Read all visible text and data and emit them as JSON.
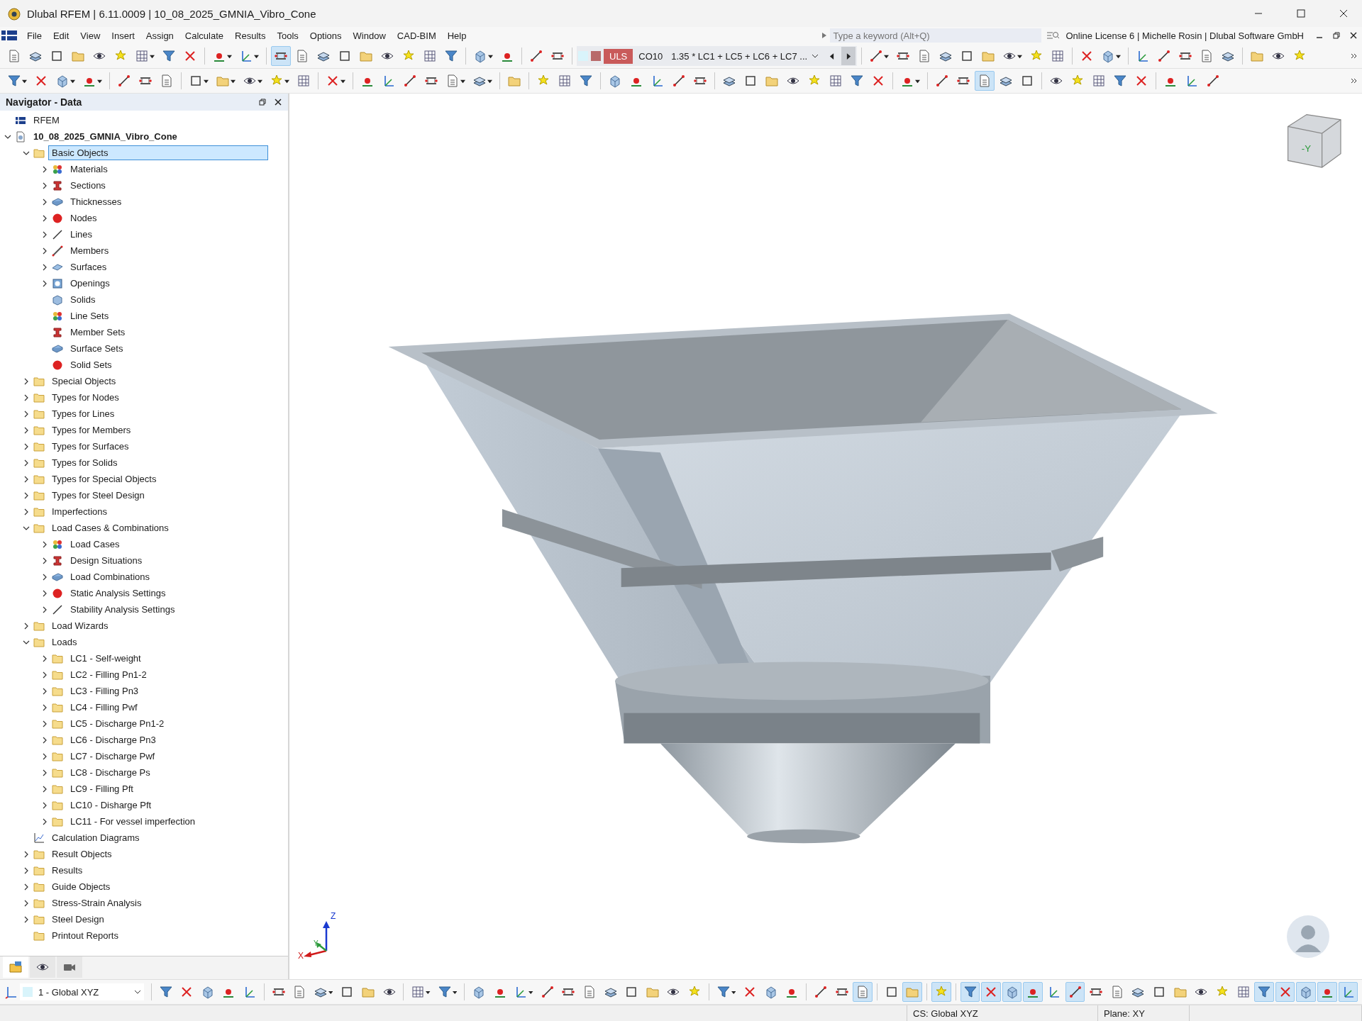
{
  "window": {
    "title": "Dlubal RFEM | 6.11.0009 | 10_08_2025_GMNIA_Vibro_Cone"
  },
  "menu": [
    "File",
    "Edit",
    "View",
    "Insert",
    "Assign",
    "Calculate",
    "Results",
    "Tools",
    "Options",
    "Window",
    "CAD-BIM",
    "Help"
  ],
  "search": {
    "placeholder": "Type a keyword (Alt+Q)"
  },
  "license": "Online License 6 | Michelle Rosin | Dlubal Software GmbH",
  "toolbar_top": {
    "left": [
      {
        "kind": "button",
        "selected": false
      },
      {
        "kind": "button",
        "selected": false
      },
      {
        "kind": "button",
        "selected": false
      },
      {
        "kind": "button",
        "selected": false
      },
      {
        "kind": "button",
        "selected": false
      },
      {
        "kind": "button",
        "selected": false
      },
      {
        "kind": "dropdown",
        "selected": false
      },
      {
        "kind": "button",
        "selected": false
      },
      {
        "kind": "button",
        "selected": false
      },
      {
        "kind": "separator"
      },
      {
        "kind": "dropdown",
        "selected": false
      },
      {
        "kind": "dropdown",
        "selected": false
      },
      {
        "kind": "separator"
      },
      {
        "kind": "button",
        "selected": true
      },
      {
        "kind": "button",
        "selected": false
      },
      {
        "kind": "button",
        "selected": false
      },
      {
        "kind": "button",
        "selected": false
      },
      {
        "kind": "button",
        "selected": false
      },
      {
        "kind": "button",
        "selected": false
      },
      {
        "kind": "button",
        "selected": false
      },
      {
        "kind": "button",
        "selected": false
      },
      {
        "kind": "button",
        "selected": false
      },
      {
        "kind": "separator"
      },
      {
        "kind": "dropdown",
        "selected": false
      },
      {
        "kind": "button",
        "selected": false
      },
      {
        "kind": "separator"
      },
      {
        "kind": "button",
        "selected": false
      },
      {
        "kind": "button",
        "selected": false
      }
    ],
    "load_selector": {
      "badge": "ULS",
      "code": "CO10",
      "combination": "1.35 * LC1 + LC5 + LC6 + LC7 ...",
      "nav": [
        {
          "selected": false
        },
        {
          "selected": true
        }
      ]
    },
    "right": [
      {
        "kind": "dropdown",
        "selected": false
      },
      {
        "kind": "button",
        "selected": false
      },
      {
        "kind": "button",
        "selected": false
      },
      {
        "kind": "button",
        "selected": false
      },
      {
        "kind": "button",
        "selected": false
      },
      {
        "kind": "button",
        "selected": false
      },
      {
        "kind": "dropdown",
        "selected": false
      },
      {
        "kind": "button",
        "selected": false
      },
      {
        "kind": "button",
        "selected": false
      },
      {
        "kind": "separator"
      },
      {
        "kind": "button",
        "selected": false
      },
      {
        "kind": "dropdown",
        "selected": false
      },
      {
        "kind": "separator"
      },
      {
        "kind": "button",
        "selected": false
      },
      {
        "kind": "button",
        "selected": false
      },
      {
        "kind": "button",
        "selected": false
      },
      {
        "kind": "button",
        "selected": false
      },
      {
        "kind": "button",
        "selected": false
      },
      {
        "kind": "separator"
      },
      {
        "kind": "button",
        "selected": false
      },
      {
        "kind": "button",
        "selected": false
      },
      {
        "kind": "button",
        "selected": false
      }
    ]
  },
  "toolbar_second": [
    {
      "kind": "dropdown",
      "selected": false
    },
    {
      "kind": "button",
      "selected": false
    },
    {
      "kind": "dropdown",
      "selected": false
    },
    {
      "kind": "dropdown",
      "selected": false
    },
    {
      "kind": "separator"
    },
    {
      "kind": "button",
      "selected": false
    },
    {
      "kind": "button",
      "selected": false
    },
    {
      "kind": "button",
      "selected": false
    },
    {
      "kind": "separator"
    },
    {
      "kind": "dropdown",
      "selected": false
    },
    {
      "kind": "dropdown",
      "selected": false
    },
    {
      "kind": "dropdown",
      "selected": false
    },
    {
      "kind": "dropdown",
      "selected": false
    },
    {
      "kind": "button",
      "selected": false
    },
    {
      "kind": "separator"
    },
    {
      "kind": "dropdown",
      "selected": false
    },
    {
      "kind": "separator"
    },
    {
      "kind": "button",
      "selected": false
    },
    {
      "kind": "button",
      "selected": false
    },
    {
      "kind": "button",
      "selected": false
    },
    {
      "kind": "button",
      "selected": false
    },
    {
      "kind": "dropdown",
      "selected": false
    },
    {
      "kind": "dropdown",
      "selected": false
    },
    {
      "kind": "separator"
    },
    {
      "kind": "button",
      "selected": false
    },
    {
      "kind": "separator"
    },
    {
      "kind": "button",
      "selected": false
    },
    {
      "kind": "button",
      "selected": false
    },
    {
      "kind": "button",
      "selected": false
    },
    {
      "kind": "separator"
    },
    {
      "kind": "button",
      "selected": false
    },
    {
      "kind": "button",
      "selected": false
    },
    {
      "kind": "button",
      "selected": false
    },
    {
      "kind": "button",
      "selected": false
    },
    {
      "kind": "button",
      "selected": false
    },
    {
      "kind": "separator"
    },
    {
      "kind": "button",
      "selected": false
    },
    {
      "kind": "button",
      "selected": false
    },
    {
      "kind": "button",
      "selected": false
    },
    {
      "kind": "button",
      "selected": false
    },
    {
      "kind": "button",
      "selected": false
    },
    {
      "kind": "button",
      "selected": false
    },
    {
      "kind": "button",
      "selected": false
    },
    {
      "kind": "button",
      "selected": false
    },
    {
      "kind": "separator"
    },
    {
      "kind": "dropdown",
      "selected": false
    },
    {
      "kind": "separator"
    },
    {
      "kind": "button",
      "selected": false
    },
    {
      "kind": "button",
      "selected": false
    },
    {
      "kind": "button",
      "selected": true
    },
    {
      "kind": "button",
      "selected": false
    },
    {
      "kind": "button",
      "selected": false
    },
    {
      "kind": "separator"
    },
    {
      "kind": "button",
      "selected": false
    },
    {
      "kind": "button",
      "selected": false
    },
    {
      "kind": "button",
      "selected": false
    },
    {
      "kind": "button",
      "selected": false
    },
    {
      "kind": "button",
      "selected": false
    },
    {
      "kind": "separator"
    },
    {
      "kind": "button",
      "selected": false
    },
    {
      "kind": "button",
      "selected": false
    },
    {
      "kind": "button",
      "selected": false
    }
  ],
  "navigator": {
    "title": "Navigator - Data",
    "tree": [
      {
        "label": "RFEM",
        "kind": "root",
        "selected": false
      },
      {
        "label": "10_08_2025_GMNIA_Vibro_Cone",
        "kind": "model",
        "selected": false,
        "expanded": true,
        "children": [
          {
            "label": "Basic Objects",
            "kind": "folder",
            "selected": true,
            "expanded": true,
            "children": [
              {
                "label": "Materials",
                "kind": "object",
                "selected": false,
                "expanded": false
              },
              {
                "label": "Sections",
                "kind": "object",
                "selected": false,
                "expanded": false
              },
              {
                "label": "Thicknesses",
                "kind": "object",
                "selected": false,
                "expanded": false
              },
              {
                "label": "Nodes",
                "kind": "object",
                "selected": false,
                "expanded": false
              },
              {
                "label": "Lines",
                "kind": "object",
                "selected": false,
                "expanded": false
              },
              {
                "label": "Members",
                "kind": "object",
                "selected": false,
                "expanded": false
              },
              {
                "label": "Surfaces",
                "kind": "object",
                "selected": false,
                "expanded": false
              },
              {
                "label": "Openings",
                "kind": "object",
                "selected": false,
                "expanded": false
              },
              {
                "label": "Solids",
                "kind": "object",
                "selected": false
              },
              {
                "label": "Line Sets",
                "kind": "object",
                "selected": false
              },
              {
                "label": "Member Sets",
                "kind": "object",
                "selected": false
              },
              {
                "label": "Surface Sets",
                "kind": "object",
                "selected": false
              },
              {
                "label": "Solid Sets",
                "kind": "object",
                "selected": false
              }
            ]
          },
          {
            "label": "Special Objects",
            "kind": "folder",
            "selected": false,
            "expanded": false
          },
          {
            "label": "Types for Nodes",
            "kind": "folder",
            "selected": false,
            "expanded": false
          },
          {
            "label": "Types for Lines",
            "kind": "folder",
            "selected": false,
            "expanded": false
          },
          {
            "label": "Types for Members",
            "kind": "folder",
            "selected": false,
            "expanded": false
          },
          {
            "label": "Types for Surfaces",
            "kind": "folder",
            "selected": false,
            "expanded": false
          },
          {
            "label": "Types for Solids",
            "kind": "folder",
            "selected": false,
            "expanded": false
          },
          {
            "label": "Types for Special Objects",
            "kind": "folder",
            "selected": false,
            "expanded": false
          },
          {
            "label": "Types for Steel Design",
            "kind": "folder",
            "selected": false,
            "expanded": false
          },
          {
            "label": "Imperfections",
            "kind": "folder",
            "selected": false,
            "expanded": false
          },
          {
            "label": "Load Cases & Combinations",
            "kind": "folder",
            "selected": false,
            "expanded": true,
            "children": [
              {
                "label": "Load Cases",
                "kind": "object",
                "selected": false,
                "expanded": false
              },
              {
                "label": "Design Situations",
                "kind": "object",
                "selected": false,
                "expanded": false
              },
              {
                "label": "Load Combinations",
                "kind": "object",
                "selected": false,
                "expanded": false
              },
              {
                "label": "Static Analysis Settings",
                "kind": "object",
                "selected": false,
                "expanded": false
              },
              {
                "label": "Stability Analysis Settings",
                "kind": "object",
                "selected": false,
                "expanded": false
              }
            ]
          },
          {
            "label": "Load Wizards",
            "kind": "folder",
            "selected": false,
            "expanded": false
          },
          {
            "label": "Loads",
            "kind": "folder",
            "selected": false,
            "expanded": true,
            "children": [
              {
                "label": "LC1 - Self-weight",
                "kind": "folder",
                "selected": false,
                "expanded": false
              },
              {
                "label": "LC2 - Filling Pn1-2",
                "kind": "folder",
                "selected": false,
                "expanded": false
              },
              {
                "label": "LC3 - Filling Pn3",
                "kind": "folder",
                "selected": false,
                "expanded": false
              },
              {
                "label": "LC4 - Filling Pwf",
                "kind": "folder",
                "selected": false,
                "expanded": false
              },
              {
                "label": "LC5 - Discharge Pn1-2",
                "kind": "folder",
                "selected": false,
                "expanded": false
              },
              {
                "label": "LC6 - Discharge Pn3",
                "kind": "folder",
                "selected": false,
                "expanded": false
              },
              {
                "label": "LC7 - Discharge Pwf",
                "kind": "folder",
                "selected": false,
                "expanded": false
              },
              {
                "label": "LC8 - Discharge Ps",
                "kind": "folder",
                "selected": false,
                "expanded": false
              },
              {
                "label": "LC9 - Filling Pft",
                "kind": "folder",
                "selected": false,
                "expanded": false
              },
              {
                "label": "LC10 - Disharge Pft",
                "kind": "folder",
                "selected": false,
                "expanded": false
              },
              {
                "label": "LC11 - For vessel imperfection",
                "kind": "folder",
                "selected": false,
                "expanded": false
              }
            ]
          },
          {
            "label": "Calculation Diagrams",
            "kind": "diagram",
            "selected": false
          },
          {
            "label": "Result Objects",
            "kind": "folder",
            "selected": false,
            "expanded": false
          },
          {
            "label": "Results",
            "kind": "folder",
            "selected": false,
            "expanded": false
          },
          {
            "label": "Guide Objects",
            "kind": "folder",
            "selected": false,
            "expanded": false
          },
          {
            "label": "Stress-Strain Analysis",
            "kind": "folder",
            "selected": false,
            "expanded": false
          },
          {
            "label": "Steel Design",
            "kind": "folder",
            "selected": false,
            "expanded": false
          },
          {
            "label": "Printout Reports",
            "kind": "folder",
            "selected": false
          }
        ]
      }
    ],
    "tabs": [
      {
        "selected": true
      },
      {
        "selected": false
      },
      {
        "selected": false
      }
    ]
  },
  "viewport": {
    "cube_label": "-Y",
    "axes": [
      "X",
      "Y",
      "Z"
    ]
  },
  "bottom_toolbar": {
    "coordinate_system": "1 - Global XYZ",
    "items": [
      {
        "kind": "separator"
      },
      {
        "kind": "button",
        "selected": false
      },
      {
        "kind": "button",
        "selected": false
      },
      {
        "kind": "button",
        "selected": false
      },
      {
        "kind": "button",
        "selected": false
      },
      {
        "kind": "button",
        "selected": false
      },
      {
        "kind": "separator"
      },
      {
        "kind": "button",
        "selected": false
      },
      {
        "kind": "button",
        "selected": false
      },
      {
        "kind": "dropdown",
        "selected": false
      },
      {
        "kind": "button",
        "selected": false
      },
      {
        "kind": "button",
        "selected": false
      },
      {
        "kind": "button",
        "selected": false
      },
      {
        "kind": "separator"
      },
      {
        "kind": "dropdown",
        "selected": false
      },
      {
        "kind": "dropdown",
        "selected": false
      },
      {
        "kind": "separator"
      },
      {
        "kind": "button",
        "selected": false
      },
      {
        "kind": "button",
        "selected": false
      },
      {
        "kind": "dropdown",
        "selected": false
      },
      {
        "kind": "button",
        "selected": false
      },
      {
        "kind": "button",
        "selected": false
      },
      {
        "kind": "button",
        "selected": false
      },
      {
        "kind": "button",
        "selected": false
      },
      {
        "kind": "button",
        "selected": false
      },
      {
        "kind": "button",
        "selected": false
      },
      {
        "kind": "button",
        "selected": false
      },
      {
        "kind": "button",
        "selected": false
      },
      {
        "kind": "separator"
      },
      {
        "kind": "dropdown",
        "selected": false
      },
      {
        "kind": "button",
        "selected": false
      },
      {
        "kind": "button",
        "selected": false
      },
      {
        "kind": "button",
        "selected": false
      },
      {
        "kind": "separator"
      },
      {
        "kind": "button",
        "selected": false
      },
      {
        "kind": "button",
        "selected": false
      },
      {
        "kind": "button",
        "selected": true
      },
      {
        "kind": "separator"
      },
      {
        "kind": "button",
        "selected": false
      },
      {
        "kind": "button",
        "selected": true
      },
      {
        "kind": "separator"
      },
      {
        "kind": "button",
        "selected": true
      },
      {
        "kind": "separator"
      },
      {
        "kind": "button",
        "selected": true
      },
      {
        "kind": "button",
        "selected": true
      },
      {
        "kind": "button",
        "selected": true
      },
      {
        "kind": "button",
        "selected": true
      },
      {
        "kind": "button",
        "selected": false
      },
      {
        "kind": "button",
        "selected": true
      },
      {
        "kind": "button",
        "selected": false
      },
      {
        "kind": "button",
        "selected": false
      },
      {
        "kind": "button",
        "selected": false
      },
      {
        "kind": "button",
        "selected": false
      },
      {
        "kind": "button",
        "selected": false
      },
      {
        "kind": "button",
        "selected": false
      },
      {
        "kind": "button",
        "selected": false
      },
      {
        "kind": "button",
        "selected": false
      },
      {
        "kind": "button",
        "selected": true
      },
      {
        "kind": "button",
        "selected": true
      },
      {
        "kind": "button",
        "selected": true
      },
      {
        "kind": "button",
        "selected": true
      },
      {
        "kind": "button",
        "selected": true
      }
    ]
  },
  "status_bar": [
    "CS: Global XYZ",
    "Plane: XY"
  ]
}
